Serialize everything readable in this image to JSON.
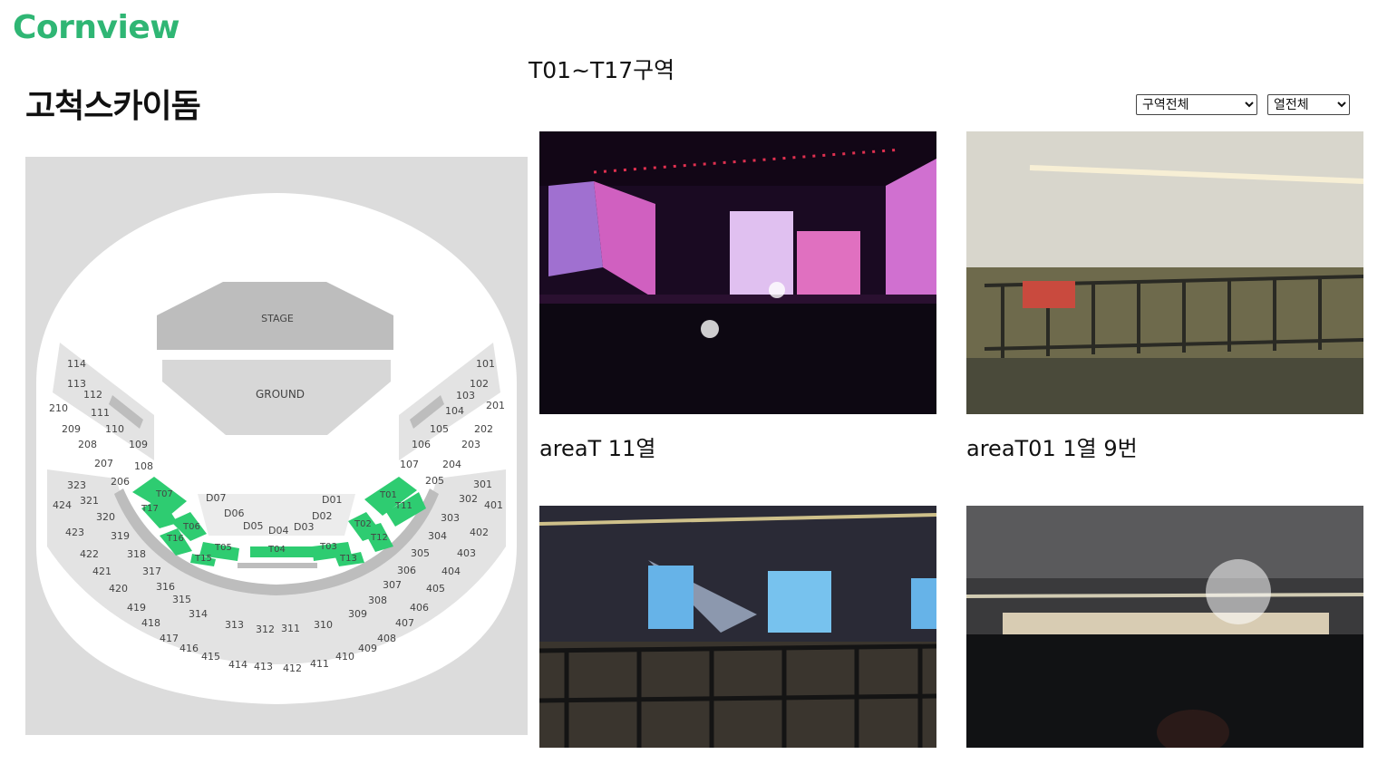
{
  "header": {
    "logo": "Cornview"
  },
  "venue": {
    "name": "고척스카이돔"
  },
  "section": {
    "heading": "T01~T17구역"
  },
  "filters": {
    "zone": {
      "selected": "구역전체"
    },
    "row": {
      "selected": "열전체"
    }
  },
  "seatmap": {
    "stage_label": "STAGE",
    "ground_label": "GROUND",
    "highlight_color": "#2ecc71",
    "sections": [
      "114",
      "113",
      "112",
      "111",
      "110",
      "109",
      "108",
      "210",
      "209",
      "208",
      "207",
      "206",
      "101",
      "102",
      "103",
      "104",
      "105",
      "106",
      "107",
      "201",
      "202",
      "203",
      "204",
      "205",
      "323",
      "321",
      "320",
      "319",
      "318",
      "317",
      "316",
      "315",
      "314",
      "313",
      "312",
      "311",
      "310",
      "309",
      "308",
      "307",
      "306",
      "305",
      "304",
      "303",
      "302",
      "301",
      "424",
      "423",
      "422",
      "421",
      "420",
      "419",
      "418",
      "417",
      "416",
      "415",
      "414",
      "413",
      "412",
      "411",
      "410",
      "409",
      "408",
      "407",
      "406",
      "405",
      "404",
      "403",
      "402",
      "401",
      "D07",
      "D06",
      "D05",
      "D04",
      "D03",
      "D02",
      "D01"
    ],
    "highlighted": [
      "T07",
      "T17",
      "T06",
      "T16",
      "T05",
      "T15",
      "T04",
      "T03",
      "T13",
      "T02",
      "T12",
      "T01",
      "T11"
    ]
  },
  "photos": [
    {
      "caption": "areaT 11열",
      "scene": "concert-stage-pink"
    },
    {
      "caption": "areaT01 1열 9번",
      "scene": "barricade-floor"
    },
    {
      "caption": "",
      "scene": "concert-blue-screens"
    },
    {
      "caption": "",
      "scene": "concert-lights-crowd"
    }
  ]
}
